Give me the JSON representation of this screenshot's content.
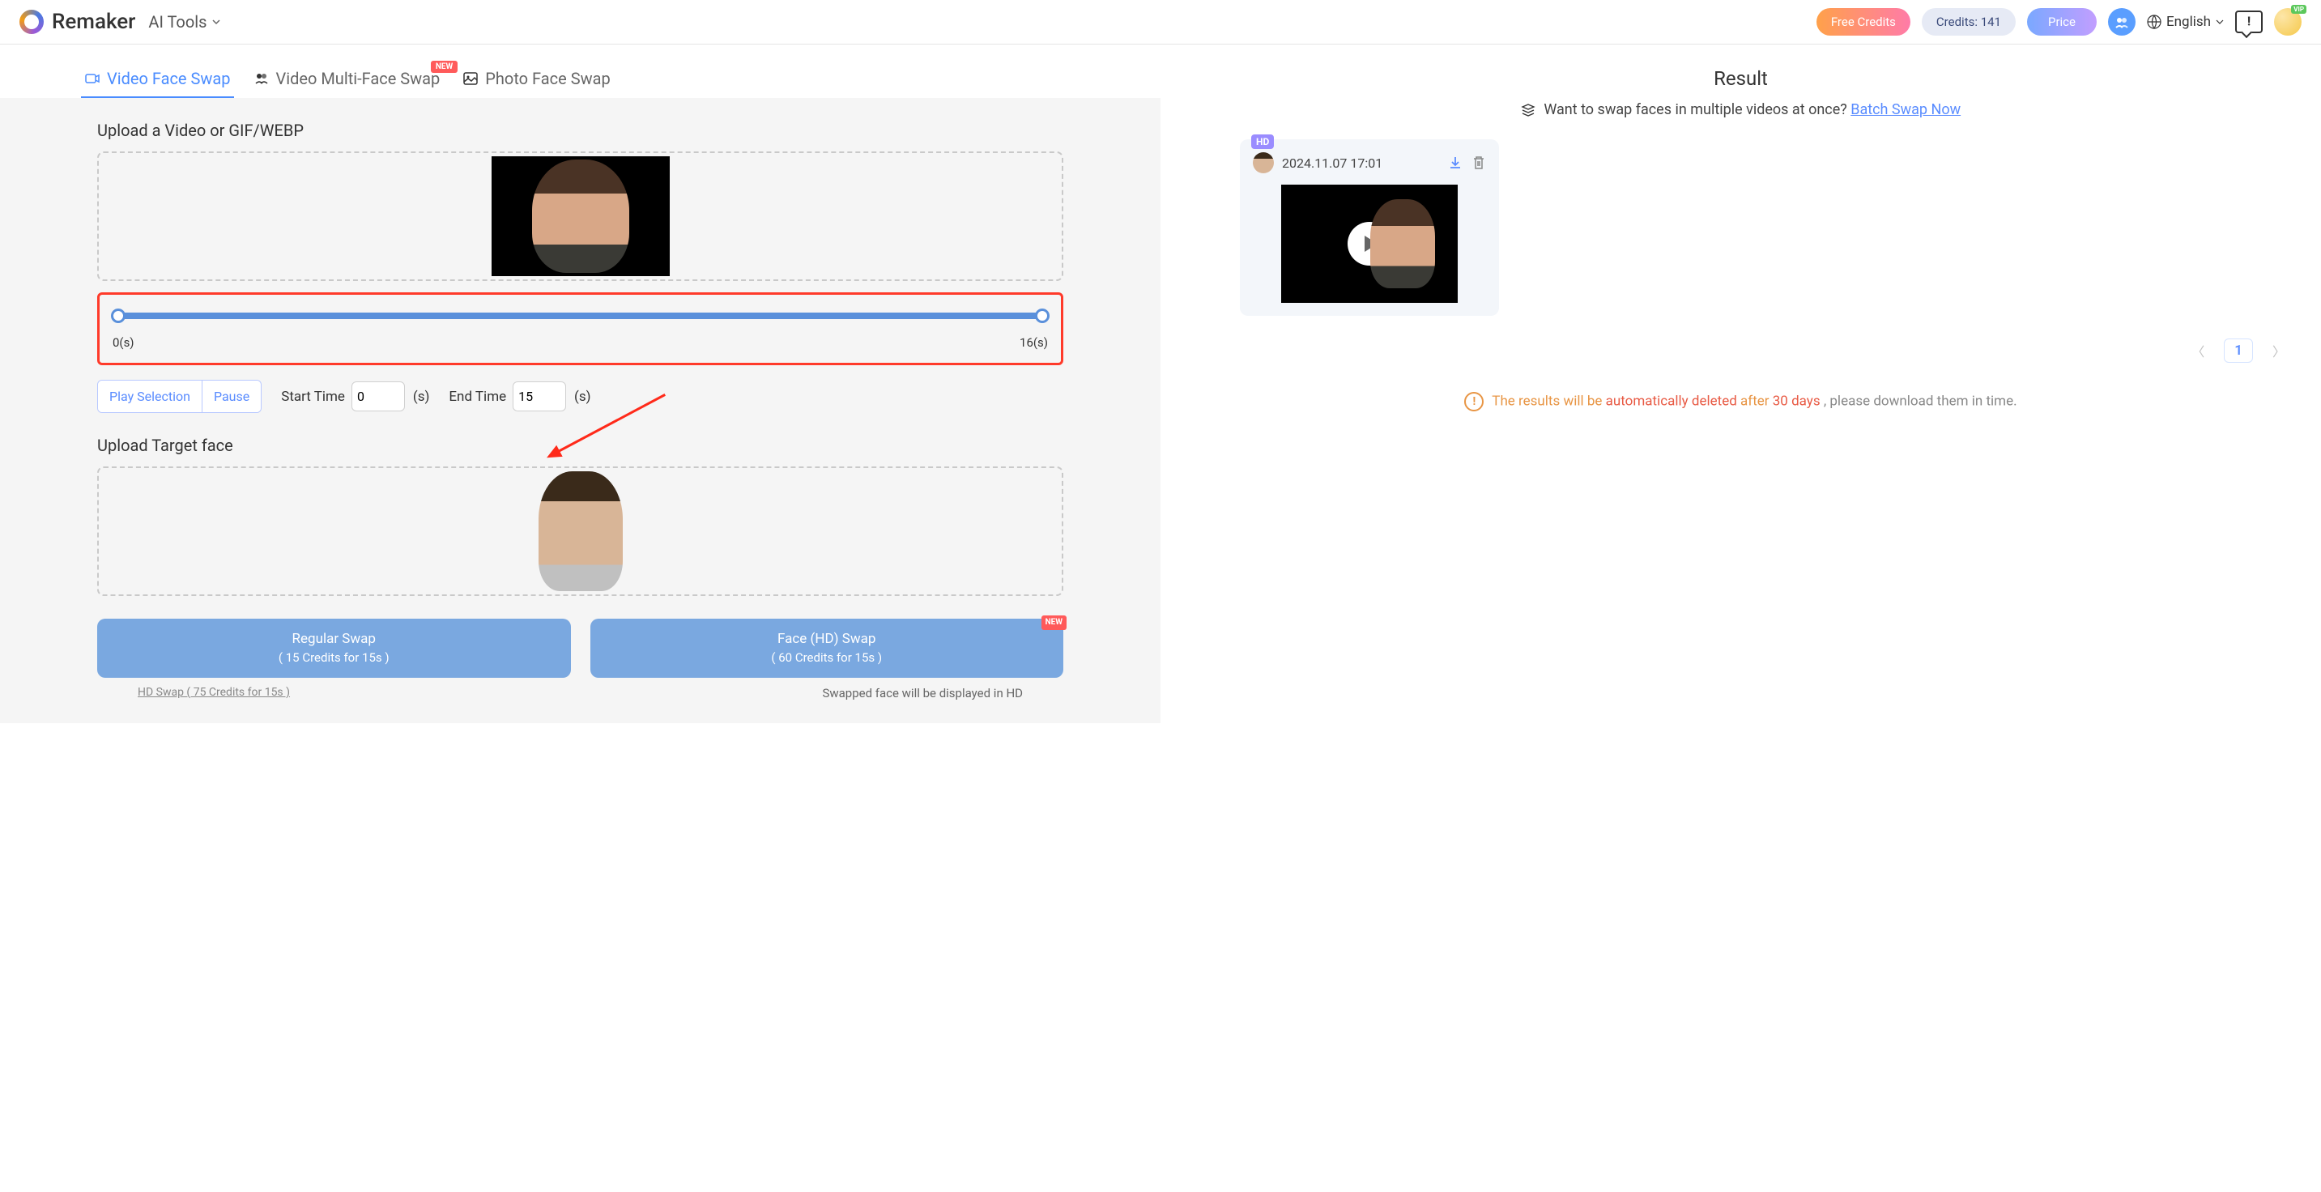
{
  "header": {
    "brand": "Remaker",
    "ai_tools_label": "AI Tools",
    "free_credits": "Free Credits",
    "credits_label": "Credits: 141",
    "price_label": "Price",
    "language_label": "English",
    "vip_badge": "VIP"
  },
  "tabs": {
    "video_face_swap": "Video Face Swap",
    "video_multi_face_swap": "Video Multi-Face Swap",
    "photo_face_swap": "Photo Face Swap",
    "new_badge": "NEW"
  },
  "upload": {
    "title": "Upload a Video or GIF/WEBP",
    "target_title": "Upload Target face"
  },
  "slider": {
    "start_label": "0(s)",
    "end_label": "16(s)"
  },
  "controls": {
    "play_selection": "Play Selection",
    "pause": "Pause",
    "start_time_label": "Start Time",
    "start_time_value": "0",
    "end_time_label": "End Time",
    "end_time_value": "15",
    "unit": "(s)"
  },
  "swap": {
    "regular_title": "Regular Swap",
    "regular_sub": "( 15 Credits for 15s )",
    "hd_title": "Face (HD) Swap",
    "hd_sub": "( 60 Credits for 15s )",
    "new_badge": "NEW",
    "hd_link": "HD Swap ( 75 Credits for 15s )",
    "hd_note": "Swapped face will be displayed in HD"
  },
  "result": {
    "title": "Result",
    "batch_prompt": "Want to swap faces in multiple videos at once?",
    "batch_link": "Batch Swap Now",
    "hd_badge": "HD",
    "timestamp": "2024.11.07 17:01",
    "page_current": "1"
  },
  "warning": {
    "prefix": "The results will be ",
    "highlight": "automatically deleted",
    "mid": " after ",
    "days": "30 days",
    "suffix": ", please download them in time."
  }
}
